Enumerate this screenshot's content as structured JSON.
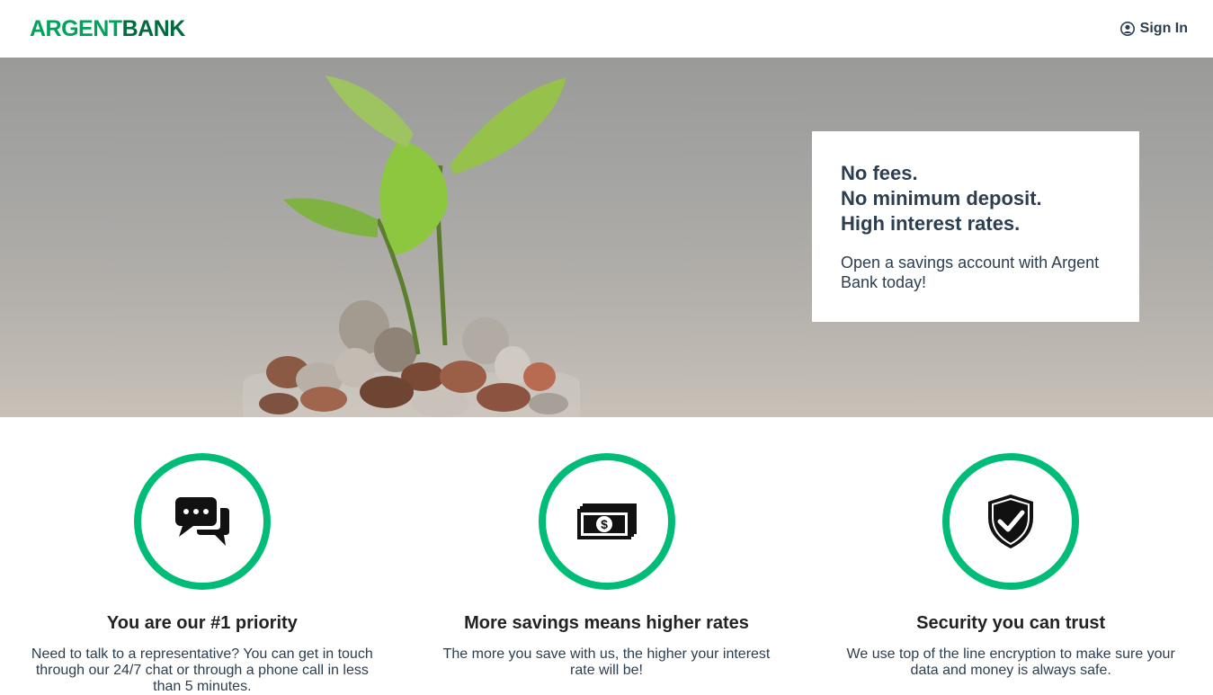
{
  "nav": {
    "logo_part1": "ARGENT",
    "logo_part2": "BANK",
    "signin_label": "Sign In",
    "signin_icon": "user-circle-icon"
  },
  "hero": {
    "headline_1": "No fees.",
    "headline_2": "No minimum deposit.",
    "headline_3": "High interest rates.",
    "subtitle": "Open a savings account with Argent Bank today!",
    "image": "plant-growing-from-coins-jar"
  },
  "features": [
    {
      "icon": "chat-icon",
      "title": "You are our #1 priority",
      "text": "Need to talk to a representative? You can get in touch through our 24/7 chat or through a phone call in less than 5 minutes."
    },
    {
      "icon": "money-icon",
      "title": "More savings means higher rates",
      "text": "The more you save with us, the higher your interest rate will be!"
    },
    {
      "icon": "security-shield-icon",
      "title": "Security you can trust",
      "text": "We use top of the line encryption to make sure your data and money is always safe."
    }
  ],
  "colors": {
    "brand_green": "#00bc77",
    "logo_dark": "#006b3c",
    "text": "#2c3e50"
  }
}
